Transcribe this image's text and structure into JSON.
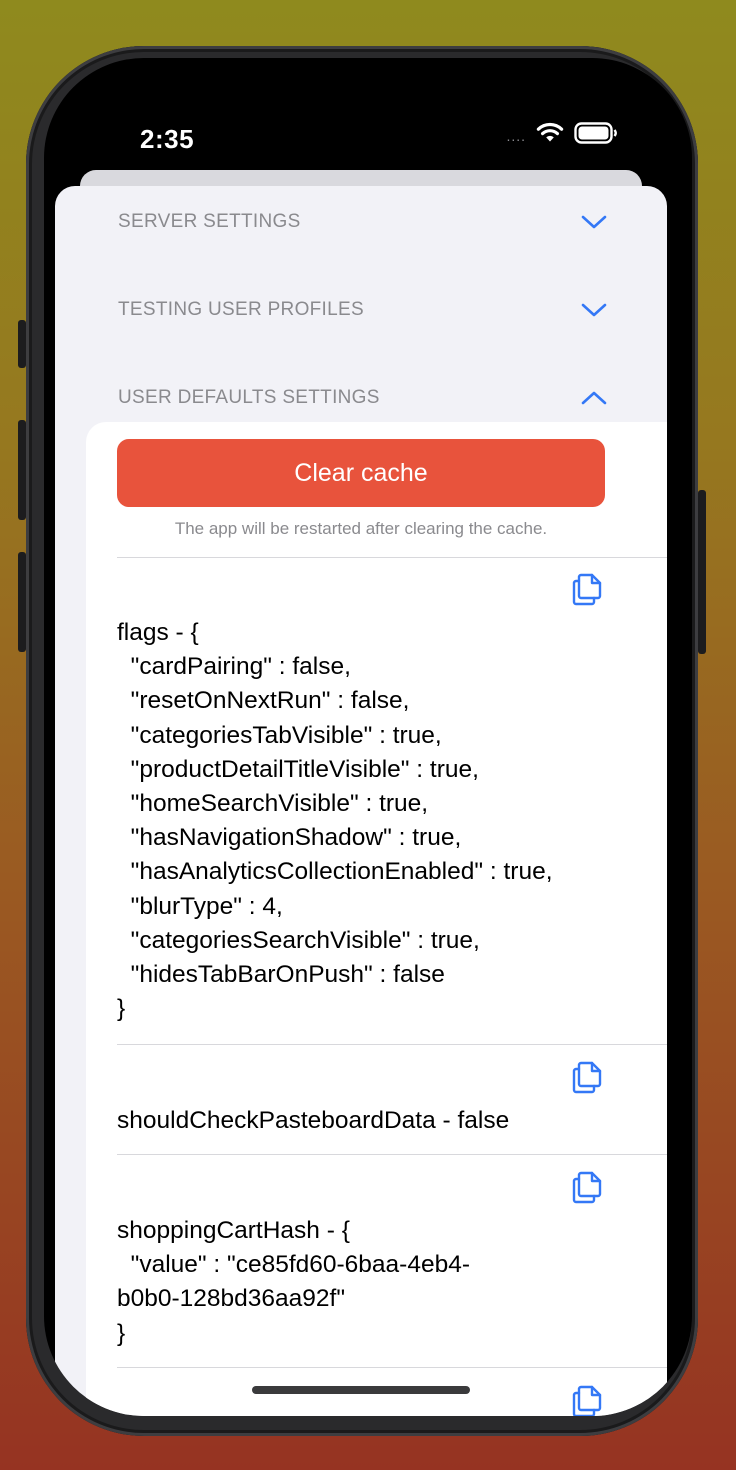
{
  "status_bar": {
    "time": "2:35",
    "signal_dots": "....",
    "icons": [
      "wifi-icon",
      "battery-icon"
    ]
  },
  "sections": [
    {
      "title": "SERVER SETTINGS",
      "expanded": false
    },
    {
      "title": "TESTING USER PROFILES",
      "expanded": false
    },
    {
      "title": "USER DEFAULTS SETTINGS",
      "expanded": true
    }
  ],
  "clear_cache": {
    "button_label": "Clear cache",
    "note": "The app will be restarted after clearing the cache."
  },
  "entries": [
    {
      "text": "flags - {\n  \"cardPairing\" : false,\n  \"resetOnNextRun\" : false,\n  \"categoriesTabVisible\" : true,\n  \"productDetailTitleVisible\" : true,\n  \"homeSearchVisible\" : true,\n  \"hasNavigationShadow\" : true,\n  \"hasAnalyticsCollectionEnabled\" : true,\n  \"blurType\" : 4,\n  \"categoriesSearchVisible\" : true,\n  \"hidesTabBarOnPush\" : false\n}"
    },
    {
      "text": "shouldCheckPasteboardData - false"
    },
    {
      "text": "shoppingCartHash - {\n  \"value\" : \"ce85fd60-6baa-4eb4-\nb0b0-128bd36aa92f\"\n}"
    }
  ],
  "colors": {
    "accent": "#3478f6",
    "destructive": "#e8533c",
    "secondary_text": "#8a8a8e",
    "sheet_background": "#f2f2f7"
  }
}
